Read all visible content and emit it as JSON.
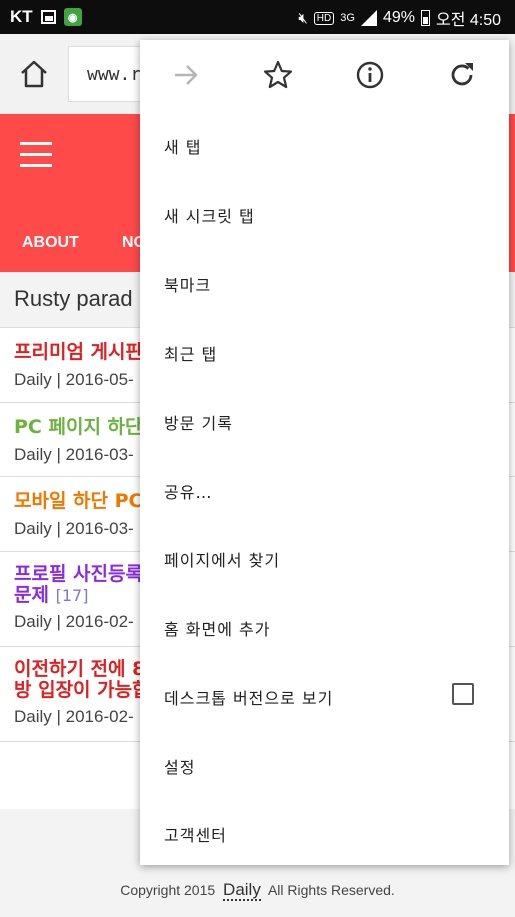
{
  "status_bar": {
    "carrier": "KT",
    "network": "3G",
    "battery": "49%",
    "time": "오전 4:50",
    "hd_badge": "HD",
    "icons": [
      "image-icon",
      "app-icon",
      "mute-icon",
      "hd-icon",
      "signal-icon",
      "battery-icon"
    ]
  },
  "browser": {
    "url": "www.r",
    "home_icon": "home-icon"
  },
  "site": {
    "nav": [
      "ABOUT",
      "NO"
    ],
    "page_title": "Rusty parad",
    "colors": {
      "header": "#ff4a4a"
    },
    "posts": [
      {
        "title": "프리미엄 게시판",
        "meta": "Daily | 2016-05-",
        "color": "#e02020"
      },
      {
        "title": "PC 페이지 하단",
        "meta": "Daily | 2016-03-",
        "color": "#6cb33e"
      },
      {
        "title": "모바일 하단 PC",
        "meta": "Daily | 2016-03-",
        "color": "#f07800"
      },
      {
        "title_line1": "프로필 사진등록",
        "title_line2": "문제",
        "comments": "[17]",
        "meta": "Daily | 2016-02-",
        "color": "#8a2be2"
      },
      {
        "title_line1": "이전하기 전에 8",
        "title_line2": "방 입장이 가능합",
        "meta": "Daily | 2016-02-",
        "color": "#e02020"
      }
    ],
    "footer": {
      "prefix": "Copyright 2015",
      "logo": "Daily",
      "suffix": "All Rights Reserved."
    }
  },
  "menu": {
    "top_icons": [
      "forward-icon",
      "star-icon",
      "info-icon",
      "refresh-icon"
    ],
    "items": [
      "새 탭",
      "새 시크릿 탭",
      "북마크",
      "최근 탭",
      "방문 기록",
      "공유…",
      "페이지에서 찾기",
      "홈 화면에 추가",
      "데스크톱 버전으로 보기",
      "설정",
      "고객센터"
    ],
    "desktop_checked": false
  }
}
